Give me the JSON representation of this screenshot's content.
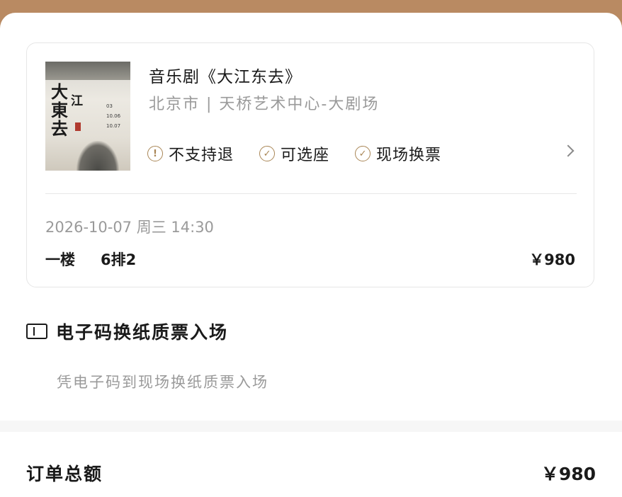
{
  "show": {
    "title": "音乐剧《大江东去》",
    "venue": "北京市 | 天桥艺术中心-大剧场",
    "poster": {
      "calligraphy_main": "大東去",
      "calligraphy_side": "江",
      "dates": [
        "03",
        "10.06",
        "10.07"
      ]
    },
    "tags": [
      {
        "icon": "exclamation-circle-icon",
        "label": "不支持退"
      },
      {
        "icon": "check-circle-icon",
        "label": "可选座"
      },
      {
        "icon": "check-circle-icon",
        "label": "现场换票"
      }
    ]
  },
  "ticket": {
    "datetime": "2026-10-07  周三  14:30",
    "floor": "一楼",
    "seat": "6排2",
    "price": "￥980"
  },
  "delivery": {
    "title": "电子码换纸质票入场",
    "description": "凭电子码到现场换纸质票入场"
  },
  "order": {
    "total_label": "订单总额",
    "total_value": "￥980"
  },
  "colors": {
    "accent": "#a98656",
    "top_bar": "#b98a62",
    "muted_text": "#9a9a9a"
  }
}
